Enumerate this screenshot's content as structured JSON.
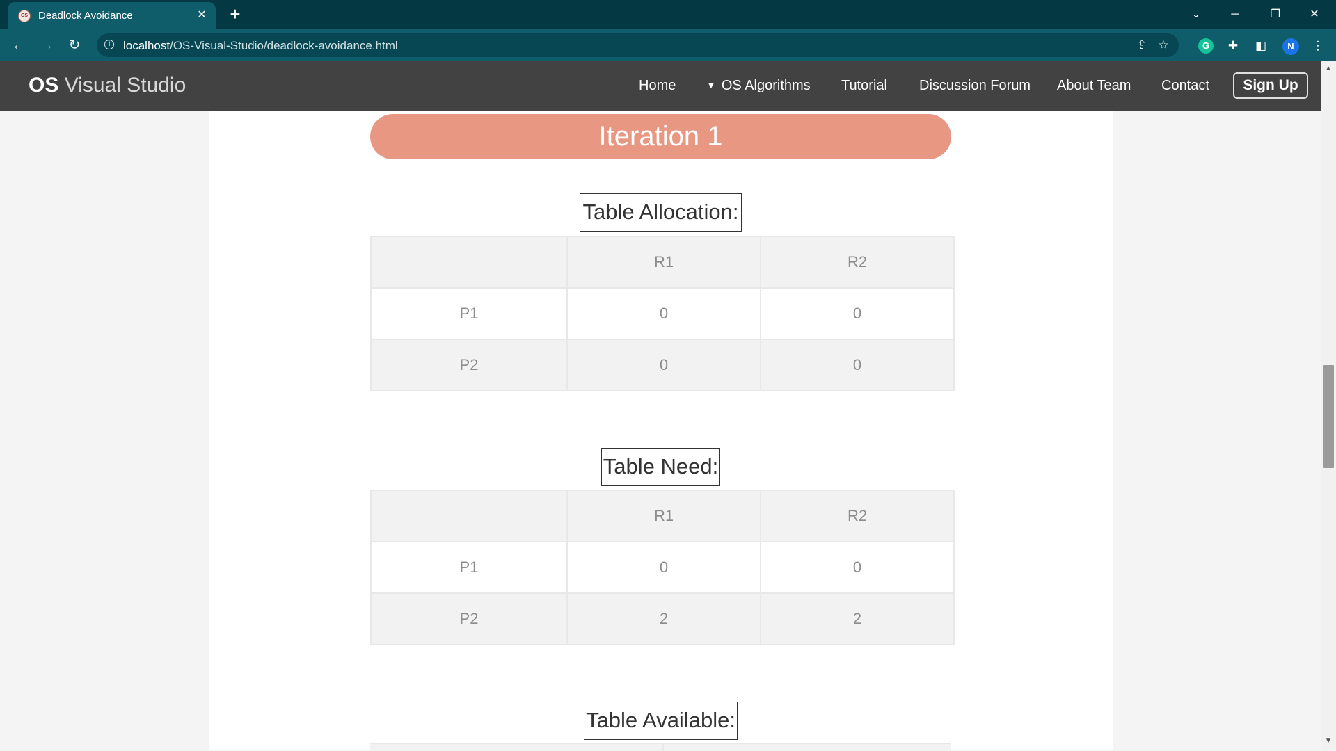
{
  "browser": {
    "tab_title": "Deadlock Avoidance",
    "favicon_text": "OS",
    "url_host": "localhost",
    "url_path": "/OS-Visual-Studio/deadlock-avoidance.html",
    "profile_initial": "N",
    "grammarly_letter": "G"
  },
  "site": {
    "brand_bold": "OS",
    "brand_rest": " Visual Studio",
    "nav": {
      "home": "Home",
      "algorithms": "OS Algorithms",
      "tutorial": "Tutorial",
      "forum": "Discussion Forum",
      "about": "About Team",
      "contact": "Contact",
      "signup": "Sign Up"
    }
  },
  "content": {
    "iteration_title": "Iteration 1",
    "allocation": {
      "heading": "Table Allocation:",
      "columns": [
        "",
        "R1",
        "R2"
      ],
      "rows": [
        {
          "label": "P1",
          "values": [
            "0",
            "0"
          ]
        },
        {
          "label": "P2",
          "values": [
            "0",
            "0"
          ]
        }
      ]
    },
    "need": {
      "heading": "Table Need:",
      "columns": [
        "",
        "R1",
        "R2"
      ],
      "rows": [
        {
          "label": "P1",
          "values": [
            "0",
            "0"
          ]
        },
        {
          "label": "P2",
          "values": [
            "2",
            "2"
          ]
        }
      ]
    },
    "available": {
      "heading": "Table Available:"
    }
  }
}
